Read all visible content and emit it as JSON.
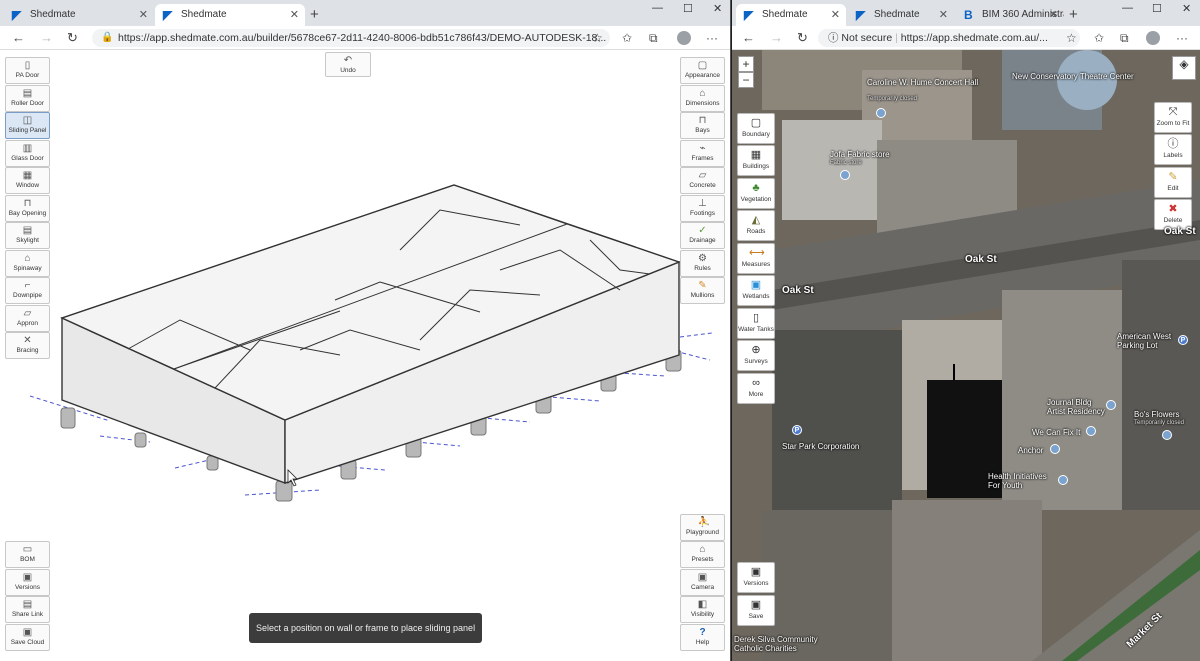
{
  "left_browser": {
    "tabs": [
      {
        "label": "Shedmate",
        "active": false
      },
      {
        "label": "Shedmate",
        "active": true
      }
    ],
    "url": "https://app.shedmate.com.au/builder/5678ce67-2d11-4240-8006-bdb51c786f43/DEMO-AUTODESK-18..."
  },
  "right_browser": {
    "tabs": [
      {
        "label": "Shedmate",
        "active": true
      },
      {
        "label": "Shedmate",
        "active": false
      },
      {
        "label": "BIM 360 Administra",
        "active": false
      }
    ],
    "not_secure": "Not secure",
    "url": "https://app.shedmate.com.au/..."
  },
  "builder": {
    "undo_label": "Undo",
    "left_tools": [
      "PA Door",
      "Roller Door",
      "Sliding Panel",
      "Glass Door",
      "Window",
      "Bay Opening",
      "Skylight",
      "Spinaway",
      "Downpipe",
      "Appron",
      "Bracing"
    ],
    "left_bottom_tools": [
      "BOM",
      "Versions",
      "Share Link",
      "Save Cloud"
    ],
    "right_tools": [
      "Appearance",
      "Dimensions",
      "Bays",
      "Frames",
      "Concrete",
      "Footings",
      "Drainage",
      "Rules",
      "Mullions"
    ],
    "right_bottom_tools": [
      "Playground",
      "Presets",
      "Camera",
      "Visibility",
      "Help"
    ],
    "toast": "Select a position on wall or frame to place sliding panel"
  },
  "map": {
    "tools": [
      "Boundary",
      "Buildings",
      "Vegetation",
      "Roads",
      "Measures",
      "Wetlands",
      "Water Tanks",
      "Surveys",
      "More"
    ],
    "bottom_tools": [
      "Versions",
      "Save"
    ],
    "right_tools": [
      "Zoom to Fit",
      "Labels",
      "Edit",
      "Delete"
    ],
    "zoom_in": "+",
    "zoom_out": "−",
    "labels": {
      "caroline": "Caroline W. Hume Concert Hall",
      "caroline_sub": "Temporarily closed",
      "conservatory": "New Conservatory Theatre Center",
      "jofa": "Jofa Fabric store",
      "jofa_sub": "Fabric store",
      "oak_st_1": "Oak St",
      "oak_st_2": "Oak St",
      "oak_st_3": "Oak St",
      "american_west": "American West Parking Lot",
      "journal": "Journal Bldg Artist Residency",
      "bos": "Bo's Flowers",
      "bos_sub": "Temporarily closed",
      "we_can": "We Can Fix It",
      "anchor": "Anchor",
      "health": "Health Initiatives For Youth",
      "star_park": "Star Park Corporation",
      "derek": "Derek Silva Community Catholic Charities",
      "market": "Market St"
    }
  }
}
